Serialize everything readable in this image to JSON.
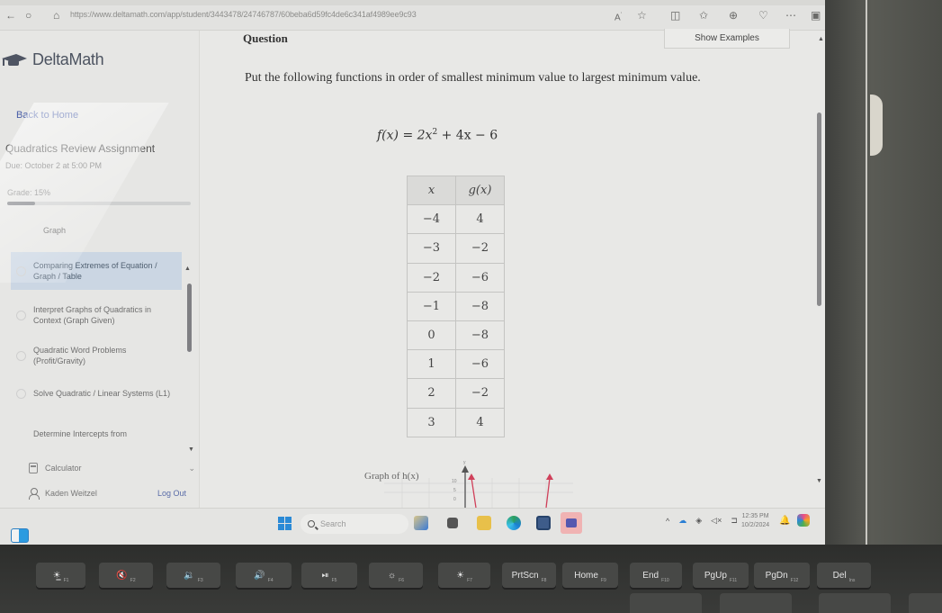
{
  "browser": {
    "url": "https://www.deltamath.com/app/student/3443478/24746787/60beba6d59fc4de6c341af4989ee9c93",
    "icons": [
      "refresh-icon",
      "home-icon",
      "read-aloud-icon",
      "favorite-icon",
      "split-screen-icon",
      "favorites-icon",
      "collections-icon",
      "browser-essentials-icon",
      "more-icon",
      "sidebar-icon"
    ]
  },
  "sidebar": {
    "brand": "DeltaMath",
    "back_link": "Back to Home",
    "assignment_title": "Quadratics Review Assignment",
    "due": "Due: October 2 at 5:00 PM",
    "grade_label": "Grade: 15%",
    "grade_progress": 0.15,
    "skills": [
      {
        "label": "Graph",
        "active": false
      },
      {
        "label": "Comparing Extremes of Equation / Graph / Table",
        "active": true
      },
      {
        "label": "Interpret Graphs of Quadratics in Context (Graph Given)",
        "active": false
      },
      {
        "label": "Quadratic Word Problems (Profit/Gravity)",
        "active": false
      },
      {
        "label": "Solve Quadratic / Linear Systems (L1)",
        "active": false
      },
      {
        "label": "Determine Intercepts from",
        "active": false
      }
    ],
    "calculator_label": "Calculator",
    "user_name": "Kaden Weitzel",
    "logout_label": "Log Out"
  },
  "main": {
    "question_label": "Question",
    "show_examples_label": "Show Examples",
    "prompt": "Put the following functions in order of smallest minimum value to largest minimum value.",
    "equation": {
      "lhs": "f(x) = 2x",
      "exp": "2",
      "rhs": " + 4x − 6"
    },
    "table": {
      "headers": [
        "x",
        "g(x)"
      ],
      "rows": [
        [
          "−4",
          "4"
        ],
        [
          "−3",
          "−2"
        ],
        [
          "−2",
          "−6"
        ],
        [
          "−1",
          "−8"
        ],
        [
          "0",
          "−8"
        ],
        [
          "1",
          "−6"
        ],
        [
          "2",
          "−2"
        ],
        [
          "3",
          "4"
        ]
      ]
    },
    "graph_label": "Graph of h(x)",
    "graph_axis_labels": [
      "y",
      "10",
      "5",
      "0"
    ],
    "curve_color": "#d0405a"
  },
  "taskbar": {
    "search_placeholder": "Search",
    "time": "12:35 PM",
    "date": "10/2/2024"
  },
  "keyboard": {
    "keys": [
      {
        "label": "☀̲",
        "fn": "F1"
      },
      {
        "label": "🔇",
        "fn": "F2"
      },
      {
        "label": "🔉",
        "fn": "F3"
      },
      {
        "label": "🔊",
        "fn": "F4"
      },
      {
        "label": "⏯",
        "fn": "F5"
      },
      {
        "label": "☼",
        "fn": "F6"
      },
      {
        "label": "☀",
        "fn": "F7"
      },
      {
        "label": "PrtScn",
        "fn": "F8"
      },
      {
        "label": "Home",
        "fn": "F9"
      },
      {
        "label": "End",
        "fn": "F10"
      },
      {
        "label": "PgUp",
        "fn": "F11"
      },
      {
        "label": "PgDn",
        "fn": "F12"
      },
      {
        "label": "Del",
        "fn": "Ins"
      }
    ]
  }
}
